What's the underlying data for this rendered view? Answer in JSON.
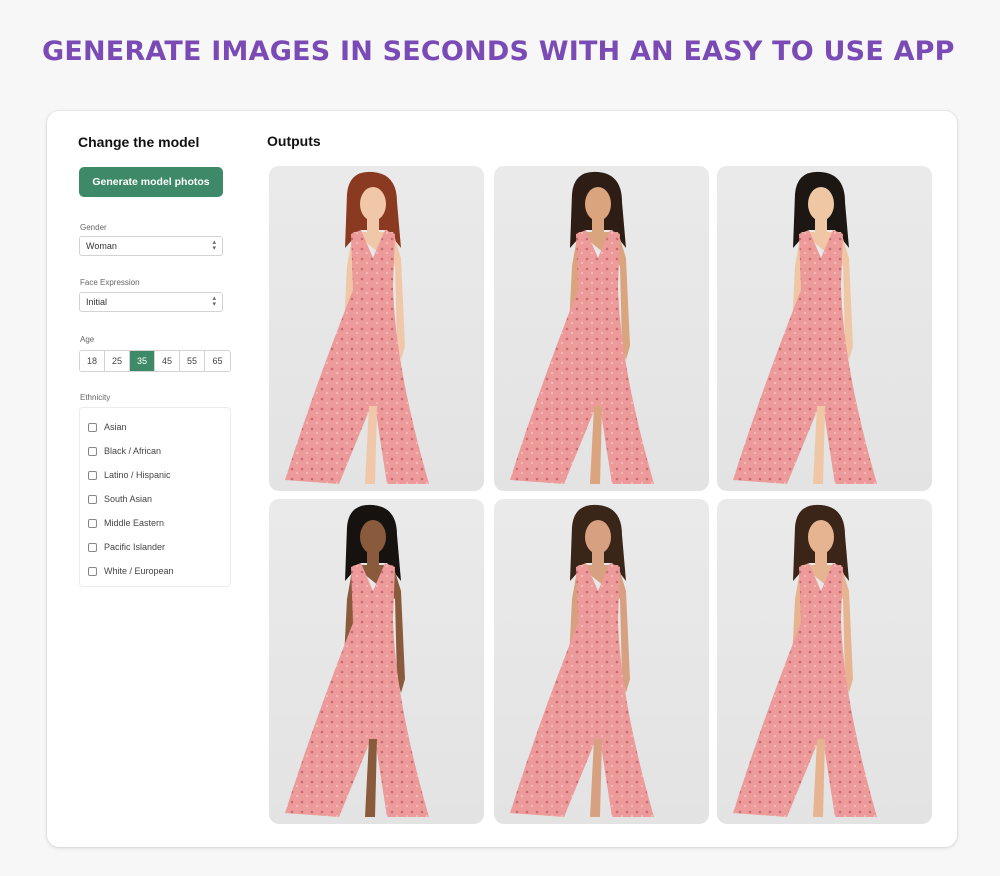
{
  "headline": "GENERATE IMAGES IN SECONDS WITH AN EASY TO USE APP",
  "sidebar": {
    "title": "Change the model",
    "generate_button": "Generate model photos",
    "gender": {
      "label": "Gender",
      "value": "Woman"
    },
    "face_expression": {
      "label": "Face Expression",
      "value": "Initial"
    },
    "age": {
      "label": "Age",
      "options": [
        "18",
        "25",
        "35",
        "45",
        "55",
        "65"
      ],
      "selected": "35"
    },
    "ethnicity": {
      "label": "Ethnicity",
      "options": [
        "Asian",
        "Black / African",
        "Latino / Hispanic",
        "South Asian",
        "Middle Eastern",
        "Pacific Islander",
        "White / European"
      ]
    }
  },
  "outputs": {
    "title": "Outputs",
    "images": [
      {
        "icon": "model-photo",
        "hair": "#8b3a22",
        "skin": "#f0c7a8"
      },
      {
        "icon": "model-photo",
        "hair": "#2d1d15",
        "skin": "#d9a47e"
      },
      {
        "icon": "model-photo",
        "hair": "#1d1713",
        "skin": "#efc7a5"
      },
      {
        "icon": "model-photo",
        "hair": "#161210",
        "skin": "#8a5a3c"
      },
      {
        "icon": "model-photo",
        "hair": "#3a2519",
        "skin": "#d7a080"
      },
      {
        "icon": "model-photo",
        "hair": "#3b2518",
        "skin": "#e7b492"
      }
    ]
  },
  "colors": {
    "headline": "#7b4bb5",
    "accent_green": "#3e8a68",
    "dress": "#ec9a9a",
    "photo_background": "#e6e6e6"
  }
}
